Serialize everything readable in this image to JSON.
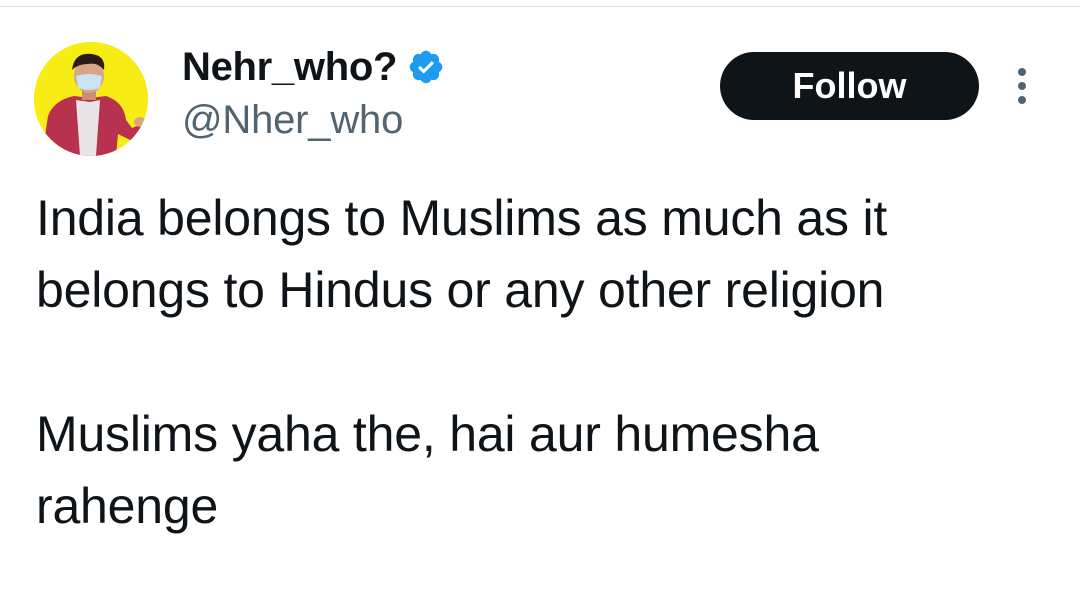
{
  "author": {
    "display_name": "Nehr_who?",
    "handle": "@Nher_who",
    "verified": true,
    "verified_badge_color": "#1d9bf0",
    "avatar_background": "#f7ec14"
  },
  "actions": {
    "follow_label": "Follow",
    "more_icon": "more-vertical-icon"
  },
  "tweet": {
    "paragraph1_line1": "India belongs to Muslims as much as it",
    "paragraph1_line2": "belongs to Hindus or any other religion",
    "paragraph2_line1": "Muslims yaha the, hai aur humesha",
    "paragraph2_line2": "rahenge"
  }
}
